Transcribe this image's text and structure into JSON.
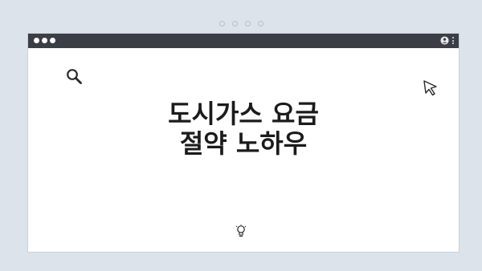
{
  "headline": {
    "line1": "도시가스 요금",
    "line2": "절약 노하우"
  },
  "icons": {
    "search": "search-icon",
    "cursor": "cursor-icon",
    "bulb": "lightbulb-icon",
    "user": "user-icon",
    "menu": "kebab-menu-icon"
  },
  "colors": {
    "page_background": "#dde3ea",
    "titlebar": "#3b3f45",
    "window_background": "#ffffff",
    "text": "#1b1b1b"
  }
}
